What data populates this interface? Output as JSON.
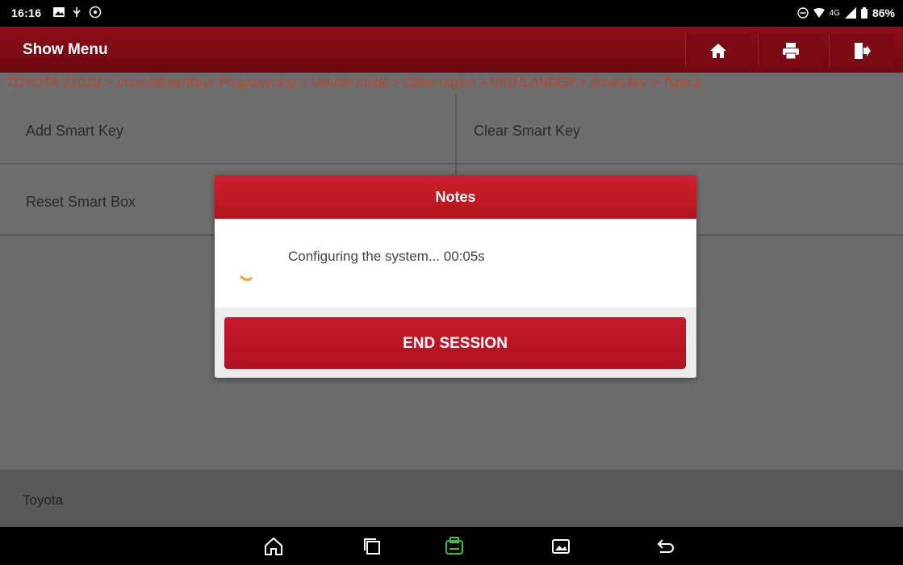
{
  "status_bar": {
    "time": "16:16",
    "network": "4G",
    "battery": "86%"
  },
  "header": {
    "title": "Show Menu",
    "buttons": [
      "home-icon",
      "print-icon",
      "exit-icon"
    ]
  },
  "breadcrumb": "TOYOTA V10.01 > Immobilizer/Keys Programming > Vehicle mode > Other region > HIGHLANDER > Smart key > Type 1",
  "menu": {
    "items": [
      {
        "label": "Add Smart Key"
      },
      {
        "label": "Clear Smart Key"
      },
      {
        "label": "Reset Smart Box"
      },
      {
        "label": ""
      }
    ]
  },
  "footer": {
    "label": "Toyota"
  },
  "dialog": {
    "title": "Notes",
    "message": "Configuring the system... 00:05s",
    "button": "END SESSION"
  },
  "nav": {
    "icons": [
      "home-icon",
      "recent-apps-icon",
      "vci-icon",
      "screenshot-icon",
      "back-icon"
    ]
  },
  "colors": {
    "header": "#8e0e18",
    "accent_red": "#c8192a",
    "breadcrumb_text": "#b8452c",
    "vci_green": "#3fbf3f",
    "spinner": "#f0a030"
  }
}
